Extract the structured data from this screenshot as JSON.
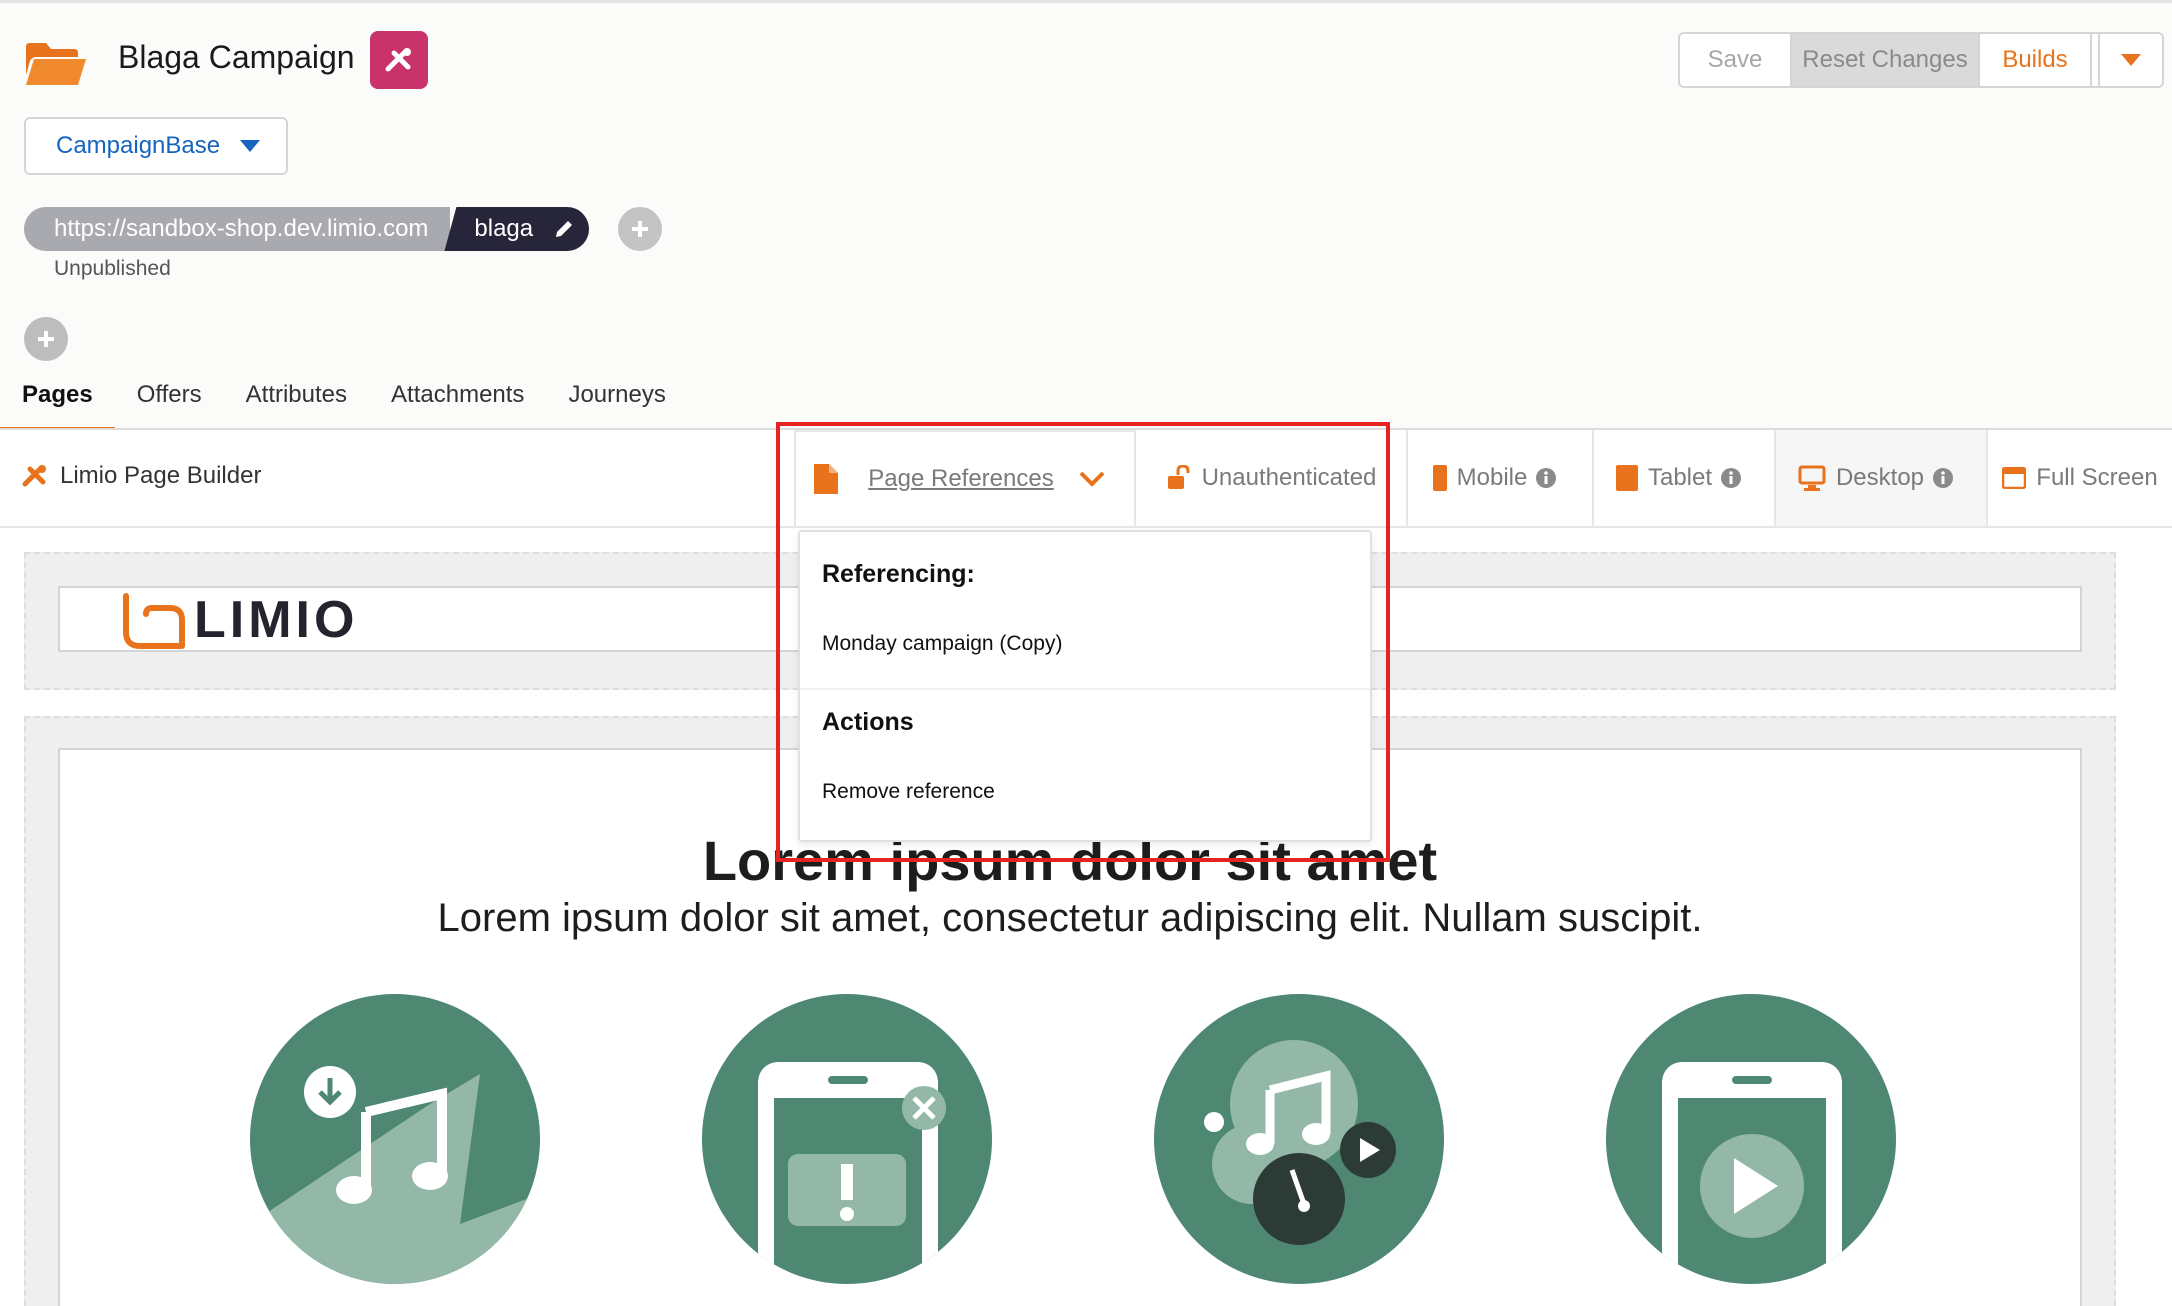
{
  "header": {
    "campaign_title": "Blaga Campaign",
    "actions": {
      "save": "Save",
      "reset": "Reset Changes",
      "builds": "Builds"
    },
    "base_select": "CampaignBase",
    "url_host": "https://sandbox-shop.dev.limio.com",
    "url_slug": "blaga",
    "status": "Unpublished",
    "accent_color": "#e8731c",
    "badge_color": "#c8346a"
  },
  "tabs": [
    {
      "label": "Pages",
      "active": true
    },
    {
      "label": "Offers",
      "active": false
    },
    {
      "label": "Attributes",
      "active": false
    },
    {
      "label": "Attachments",
      "active": false
    },
    {
      "label": "Journeys",
      "active": false
    }
  ],
  "toolbar": {
    "builder_label": "Limio Page Builder",
    "page_references": "Page References",
    "unauthenticated": "Unauthenticated",
    "mobile": "Mobile",
    "tablet": "Tablet",
    "desktop": "Desktop",
    "full_screen": "Full Screen"
  },
  "dropdown": {
    "referencing_heading": "Referencing:",
    "referencing_item": "Monday campaign (Copy)",
    "actions_heading": "Actions",
    "remove_item": "Remove reference"
  },
  "canvas": {
    "logo_text": "LIMIO",
    "hero_title": "Lorem ipsum dolor sit amet",
    "hero_subtitle": "Lorem ipsum dolor sit amet, consectetur adipiscing elit. Nullam suscipit.",
    "feature_color": "#4e8872"
  }
}
